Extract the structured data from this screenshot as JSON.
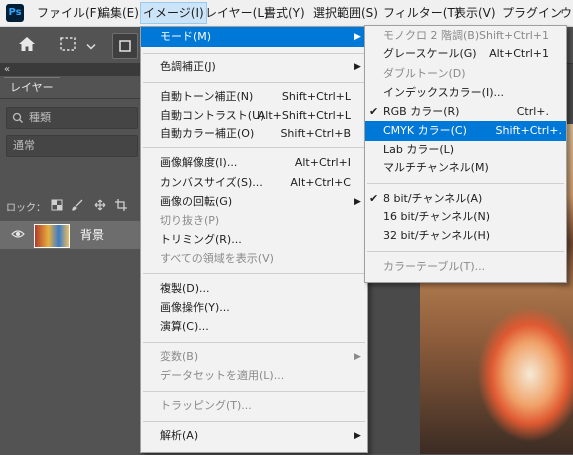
{
  "app": {
    "logo": "Ps"
  },
  "menubar": {
    "items": [
      {
        "label": "ファイル(F)"
      },
      {
        "label": "編集(E)"
      },
      {
        "label": "イメージ(I)"
      },
      {
        "label": "レイヤー(L)"
      },
      {
        "label": "書式(Y)"
      },
      {
        "label": "選択範囲(S)"
      },
      {
        "label": "フィルター(T)"
      },
      {
        "label": "表示(V)"
      },
      {
        "label": "プラグイン"
      },
      {
        "label": "ウィ"
      }
    ]
  },
  "options_bar": {
    "icons": [
      "home-icon",
      "marquee-icon",
      "chevron-down-icon",
      "square-icon"
    ]
  },
  "layers_panel": {
    "collapse_icon": "«",
    "tab_label": "レイヤー",
    "search_placeholder": "種類",
    "blend_mode": "通常",
    "lock_label": "ロック：",
    "layer": {
      "name": "背景"
    }
  },
  "image_menu": {
    "items": [
      {
        "label": "モード(M)",
        "submenu": true,
        "highlighted": true
      },
      {
        "label": "色調補正(J)",
        "submenu": true
      },
      {
        "label": "自動トーン補正(N)",
        "shortcut": "Shift+Ctrl+L"
      },
      {
        "label": "自動コントラスト(U)",
        "shortcut": "Alt+Shift+Ctrl+L"
      },
      {
        "label": "自動カラー補正(O)",
        "shortcut": "Shift+Ctrl+B"
      },
      {
        "label": "画像解像度(I)...",
        "shortcut": "Alt+Ctrl+I"
      },
      {
        "label": "カンバスサイズ(S)...",
        "shortcut": "Alt+Ctrl+C"
      },
      {
        "label": "画像の回転(G)",
        "submenu": true
      },
      {
        "label": "切り抜き(P)",
        "disabled": true
      },
      {
        "label": "トリミング(R)..."
      },
      {
        "label": "すべての領域を表示(V)",
        "disabled": true
      },
      {
        "label": "複製(D)..."
      },
      {
        "label": "画像操作(Y)..."
      },
      {
        "label": "演算(C)..."
      },
      {
        "label": "変数(B)",
        "submenu": true,
        "disabled": true
      },
      {
        "label": "データセットを適用(L)...",
        "disabled": true
      },
      {
        "label": "トラッピング(T)...",
        "disabled": true
      },
      {
        "label": "解析(A)",
        "submenu": true
      }
    ]
  },
  "mode_menu": {
    "items": [
      {
        "label": "モノクロ 2 階調(B)",
        "shortcut": "Shift+Ctrl+1",
        "disabled": true
      },
      {
        "label": "グレースケール(G)",
        "shortcut": "Alt+Ctrl+1"
      },
      {
        "label": "ダブルトーン(D)",
        "disabled": true
      },
      {
        "label": "インデックスカラー(I)..."
      },
      {
        "label": "RGB カラー(R)",
        "shortcut": "Ctrl+.",
        "checked": true
      },
      {
        "label": "CMYK カラー(C)",
        "shortcut": "Shift+Ctrl+.",
        "highlighted": true
      },
      {
        "label": "Lab カラー(L)"
      },
      {
        "label": "マルチチャンネル(M)"
      },
      {
        "label": "8 bit/チャンネル(A)",
        "checked": true
      },
      {
        "label": "16 bit/チャンネル(N)"
      },
      {
        "label": "32 bit/チャンネル(H)"
      },
      {
        "label": "カラーテーブル(T)...",
        "disabled": true
      }
    ]
  },
  "colors": {
    "highlight": "#0078d7",
    "menu_bg": "#f2f2f2",
    "panel_bg": "#535353"
  }
}
